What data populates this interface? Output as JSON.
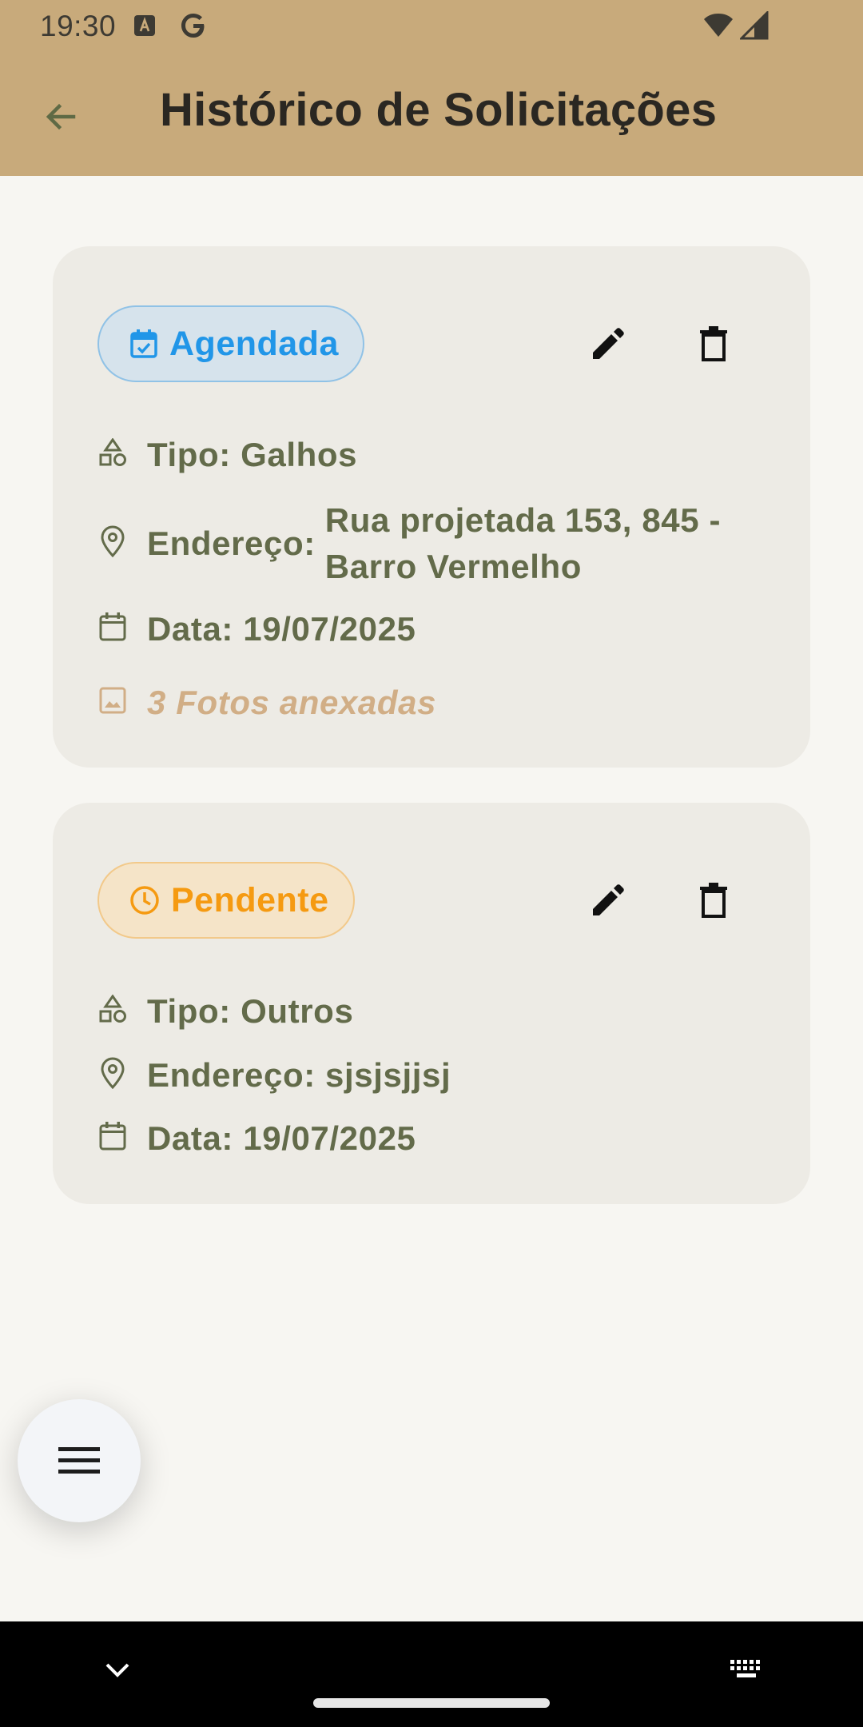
{
  "status_bar": {
    "time": "19:30"
  },
  "header": {
    "title": "Histórico de Solicitações",
    "back_icon": "arrow-back-icon"
  },
  "colors": {
    "header_bg": "#c8aa7b",
    "card_bg": "#edebe5",
    "text_primary": "#636b4a",
    "scheduled": "#2196e8",
    "pending": "#f59a11",
    "photos": "#d1ae86"
  },
  "requests": [
    {
      "status": "Agendada",
      "status_icon": "calendar-check-icon",
      "type_label": "Tipo: Galhos",
      "address_label": "Endereço:",
      "address_value": "Rua projetada 153, 845 - Barro Vermelho",
      "date_label": "Data: 19/07/2025",
      "photos_label": "3 Fotos anexadas"
    },
    {
      "status": "Pendente",
      "status_icon": "clock-icon",
      "type_label": "Tipo: Outros",
      "address_label": "Endereço: sjsjsjjsj",
      "date_label": "Data: 19/07/2025"
    }
  ],
  "fab": {
    "icon": "menu-icon"
  }
}
